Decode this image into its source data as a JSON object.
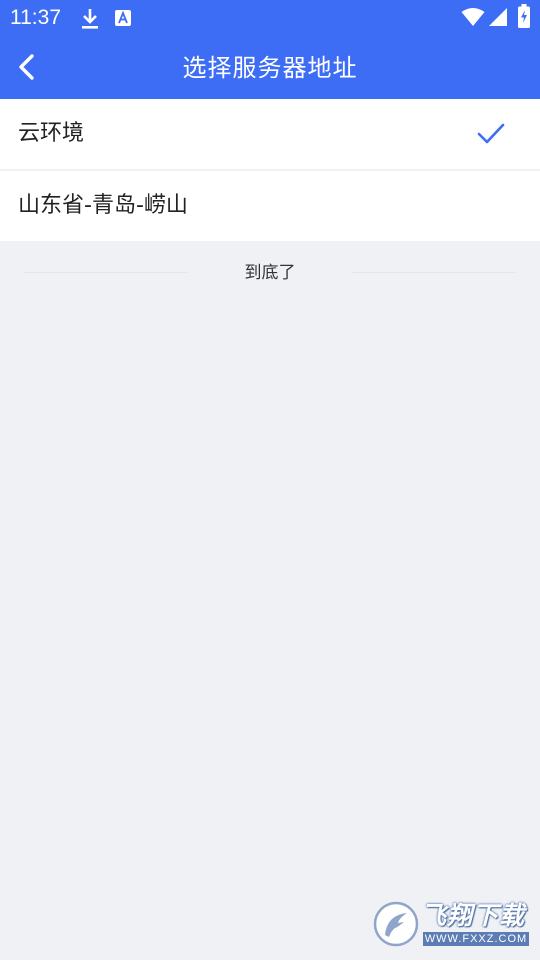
{
  "status_bar": {
    "time": "11:37",
    "icons": [
      "download-icon",
      "app-notification-icon",
      "wifi-icon",
      "cellular-signal-icon",
      "battery-charging-icon"
    ]
  },
  "header": {
    "title": "选择服务器地址",
    "back_icon": "chevron-left-icon"
  },
  "servers": {
    "items": [
      {
        "label": "云环境",
        "selected": true
      },
      {
        "label": "山东省-青岛-崂山",
        "selected": false
      }
    ]
  },
  "list_end": {
    "text": "到底了"
  },
  "watermark": {
    "title": "飞翔下载",
    "url": "WWW.FXXZ.COM"
  },
  "colors": {
    "primary": "#3d6df5",
    "background": "#f0f1f5",
    "check": "#3d6df5"
  }
}
